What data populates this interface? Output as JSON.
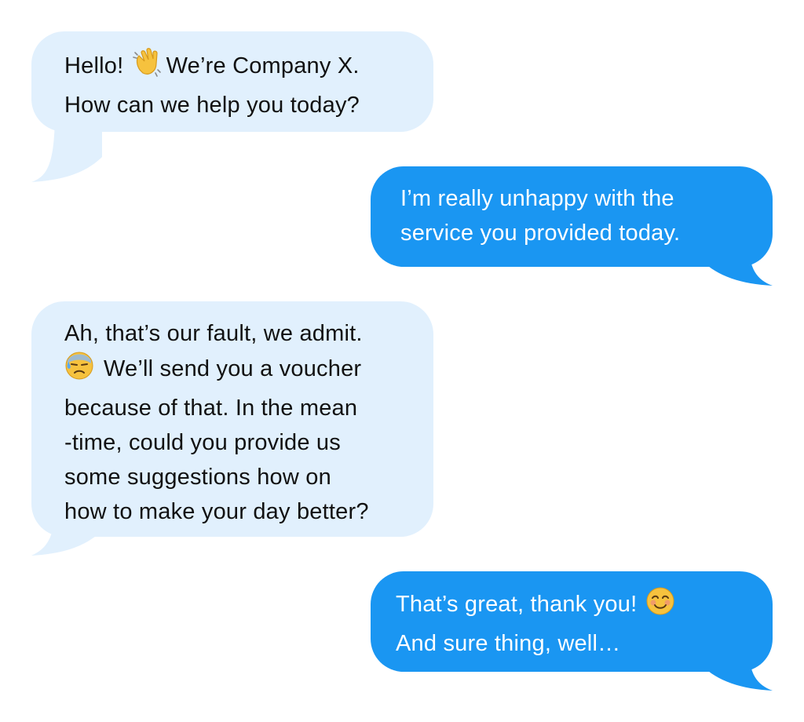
{
  "conversation": {
    "messages": [
      {
        "sender": "company",
        "lines": [
          "Hello! ",
          "We’re Company X.",
          "How can we help you today?"
        ],
        "emoji": "waving-hand-icon"
      },
      {
        "sender": "user",
        "lines": [
          "I’m really unhappy with the",
          "service you provided today."
        ]
      },
      {
        "sender": "company",
        "lines": [
          "Ah, that’s our fault, we admit.",
          "We’ll send you a voucher",
          "because of that. In the mean",
          "-time, could you provide us",
          "some suggestions how on",
          "how to make your day better?"
        ],
        "emoji": "downcast-sweat-face-icon"
      },
      {
        "sender": "user",
        "lines": [
          "That’s great, thank you! ",
          "And sure thing, well…"
        ],
        "emoji": "smiling-face-icon"
      }
    ]
  },
  "colors": {
    "incoming_bubble": "#e1f0fd",
    "outgoing_bubble": "#1a96f2",
    "incoming_text": "#111111",
    "outgoing_text": "#ffffff"
  }
}
